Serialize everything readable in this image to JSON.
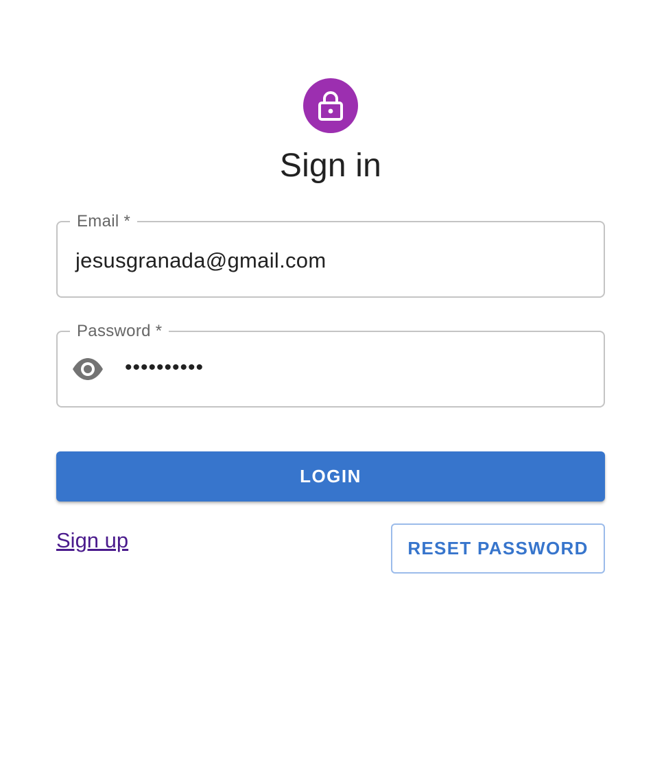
{
  "header": {
    "icon": "lock-icon",
    "icon_bg_color": "#9c2fb0",
    "title": "Sign in"
  },
  "form": {
    "email": {
      "label": "Email *",
      "value": "jesusgranada@gmail.com"
    },
    "password": {
      "label": "Password *",
      "value": "••••••••••",
      "toggle_icon": "eye-icon"
    },
    "login_label": "LOGIN",
    "login_color": "#3775cc"
  },
  "footer": {
    "signup_label": "Sign up",
    "reset_label": "RESET PASSWORD"
  }
}
